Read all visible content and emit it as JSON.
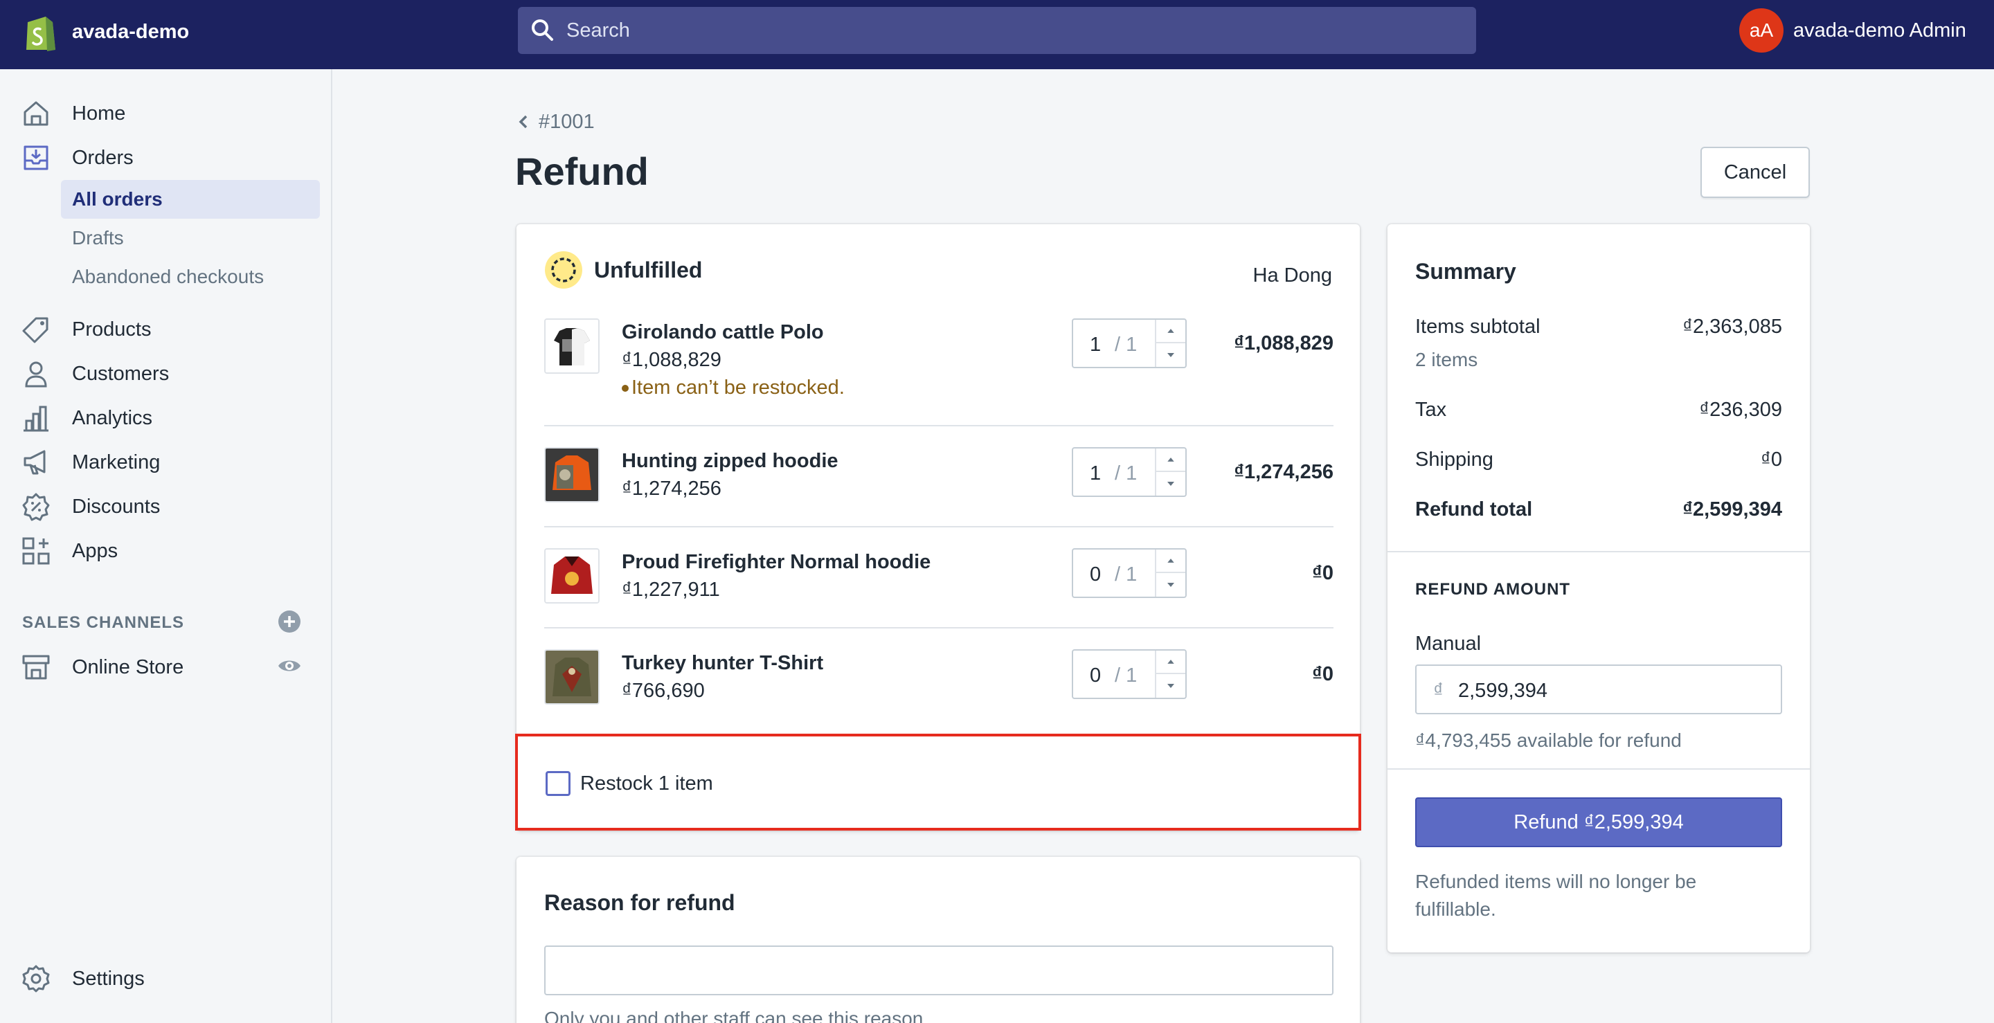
{
  "topbar": {
    "store_name": "avada-demo",
    "search_placeholder": "Search",
    "avatar_initials": "aA",
    "admin_name": "avada-demo Admin"
  },
  "sidebar": {
    "items": [
      {
        "label": "Home",
        "icon": "home-icon"
      },
      {
        "label": "Orders",
        "icon": "orders-icon"
      },
      {
        "label": "Products",
        "icon": "tag-icon"
      },
      {
        "label": "Customers",
        "icon": "person-icon"
      },
      {
        "label": "Analytics",
        "icon": "bar-chart-icon"
      },
      {
        "label": "Marketing",
        "icon": "megaphone-icon"
      },
      {
        "label": "Discounts",
        "icon": "discount-icon"
      },
      {
        "label": "Apps",
        "icon": "apps-icon"
      }
    ],
    "orders_sub": [
      "All orders",
      "Drafts",
      "Abandoned checkouts"
    ],
    "sales_channels_title": "SALES CHANNELS",
    "online_store": "Online Store",
    "settings": "Settings"
  },
  "page": {
    "back_label": "#1001",
    "title": "Refund",
    "cancel_label": "Cancel"
  },
  "fulfillment": {
    "status": "Unfulfilled",
    "location": "Ha Dong",
    "items": [
      {
        "name": "Girolando cattle Polo",
        "price": "₫1,088,829",
        "qty": "1",
        "max": "/ 1",
        "total": "₫1,088,829",
        "warning": "Item can’t be restocked."
      },
      {
        "name": "Hunting zipped hoodie",
        "price": "₫1,274,256",
        "qty": "1",
        "max": "/ 1",
        "total": "₫1,274,256"
      },
      {
        "name": "Proud Firefighter Normal hoodie",
        "price": "₫1,227,911",
        "qty": "0",
        "max": "/ 1",
        "total": "₫0"
      },
      {
        "name": "Turkey hunter T-Shirt",
        "price": "₫766,690",
        "qty": "0",
        "max": "/ 1",
        "total": "₫0"
      }
    ],
    "restock_label": "Restock 1 item"
  },
  "reason": {
    "title": "Reason for refund",
    "help": "Only you and other staff can see this reason."
  },
  "summary": {
    "title": "Summary",
    "items_subtotal_label": "Items subtotal",
    "items_subtotal_value": "₫2,363,085",
    "items_count": "2 items",
    "tax_label": "Tax",
    "tax_value": "₫236,309",
    "shipping_label": "Shipping",
    "shipping_value": "₫0",
    "refund_total_label": "Refund total",
    "refund_total_value": "₫2,599,394",
    "refund_amount_title": "REFUND AMOUNT",
    "manual_label": "Manual",
    "currency_symbol": "₫",
    "amount_value": "2,599,394",
    "available": "₫4,793,455 available for refund",
    "refund_button": "Refund ₫2,599,394",
    "note": "Refunded items will no longer be fulfillable."
  },
  "colors": {
    "topbar": "#1c2260",
    "accent": "#5c6ac4",
    "highlight_border": "#e62b1e",
    "warning": "#8a6116"
  }
}
